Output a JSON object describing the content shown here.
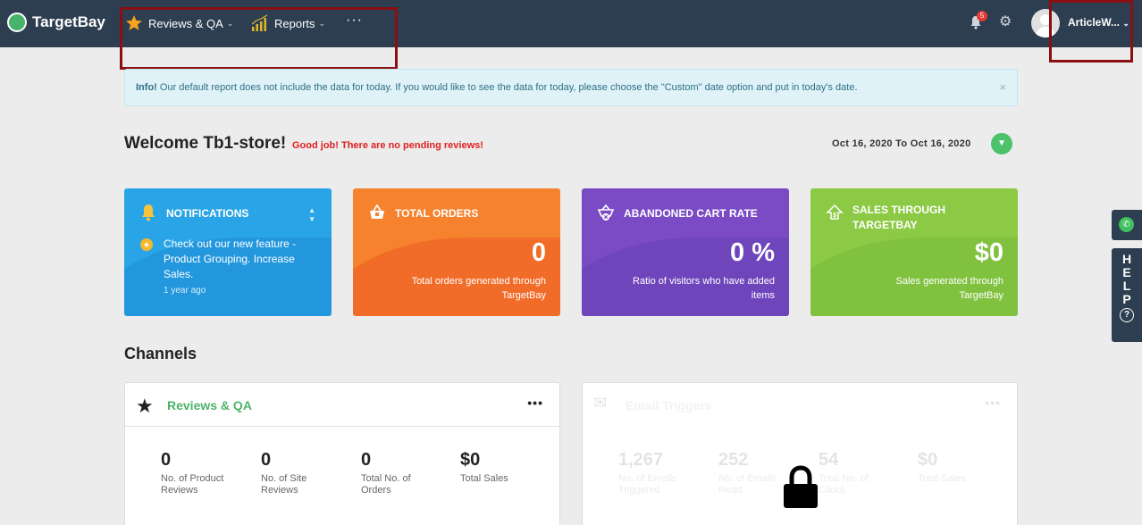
{
  "nav": {
    "brand": "TargetBay",
    "items": [
      {
        "label": "Reviews & QA"
      },
      {
        "label": "Reports"
      }
    ],
    "more": "···",
    "notification_count": "5",
    "user_name": "ArticleW...",
    "colors": {
      "bar": "#2c3e50",
      "highlight": "#8b0e12"
    }
  },
  "info": {
    "label": "Info!",
    "message": "Our default report does not include the data for today. If you would like to see the data for today, please choose the \"Custom\" date option and put in today's date.",
    "close": "×"
  },
  "welcome": {
    "title": "Welcome Tb1-store!",
    "pending": "Good job! There are no pending reviews!",
    "date_range": "Oct 16, 2020 To Oct 16, 2020",
    "date_button_icon": "chevron-down-icon"
  },
  "cards": {
    "notifications": {
      "title": "NOTIFICATIONS",
      "text": "Check out our new feature - Product Grouping. Increase Sales.",
      "time": "1 year ago"
    },
    "total_orders": {
      "title": "TOTAL ORDERS",
      "value": "0",
      "sub": "Total orders generated through TargetBay"
    },
    "abandoned": {
      "title": "ABANDONED CART RATE",
      "value": "0 %",
      "sub": "Ratio of visitors who have added items"
    },
    "sales": {
      "title": "SALES THROUGH TARGETBAY",
      "value": "$0",
      "sub": "Sales generated through TargetBay"
    }
  },
  "channels": {
    "heading": "Channels",
    "reviews": {
      "title": "Reviews & QA",
      "more": "•••",
      "stats": [
        {
          "num": "0",
          "label": "No. of Product Reviews"
        },
        {
          "num": "0",
          "label": "No. of Site Reviews"
        },
        {
          "num": "0",
          "label": "Total No. of Orders"
        },
        {
          "num": "$0",
          "label": "Total Sales"
        }
      ]
    },
    "email": {
      "title": "Email Triggers",
      "more": "•••",
      "stats": [
        {
          "num": "1,267",
          "label": "No. of Emails Triggered"
        },
        {
          "num": "252",
          "label": "No. of Emails Read"
        },
        {
          "num": "54",
          "label": "Total No. of Clicks"
        },
        {
          "num": "$0",
          "label": "Total Sales"
        }
      ]
    }
  },
  "help": {
    "letters": [
      "H",
      "E",
      "L",
      "P"
    ],
    "q": "?"
  }
}
